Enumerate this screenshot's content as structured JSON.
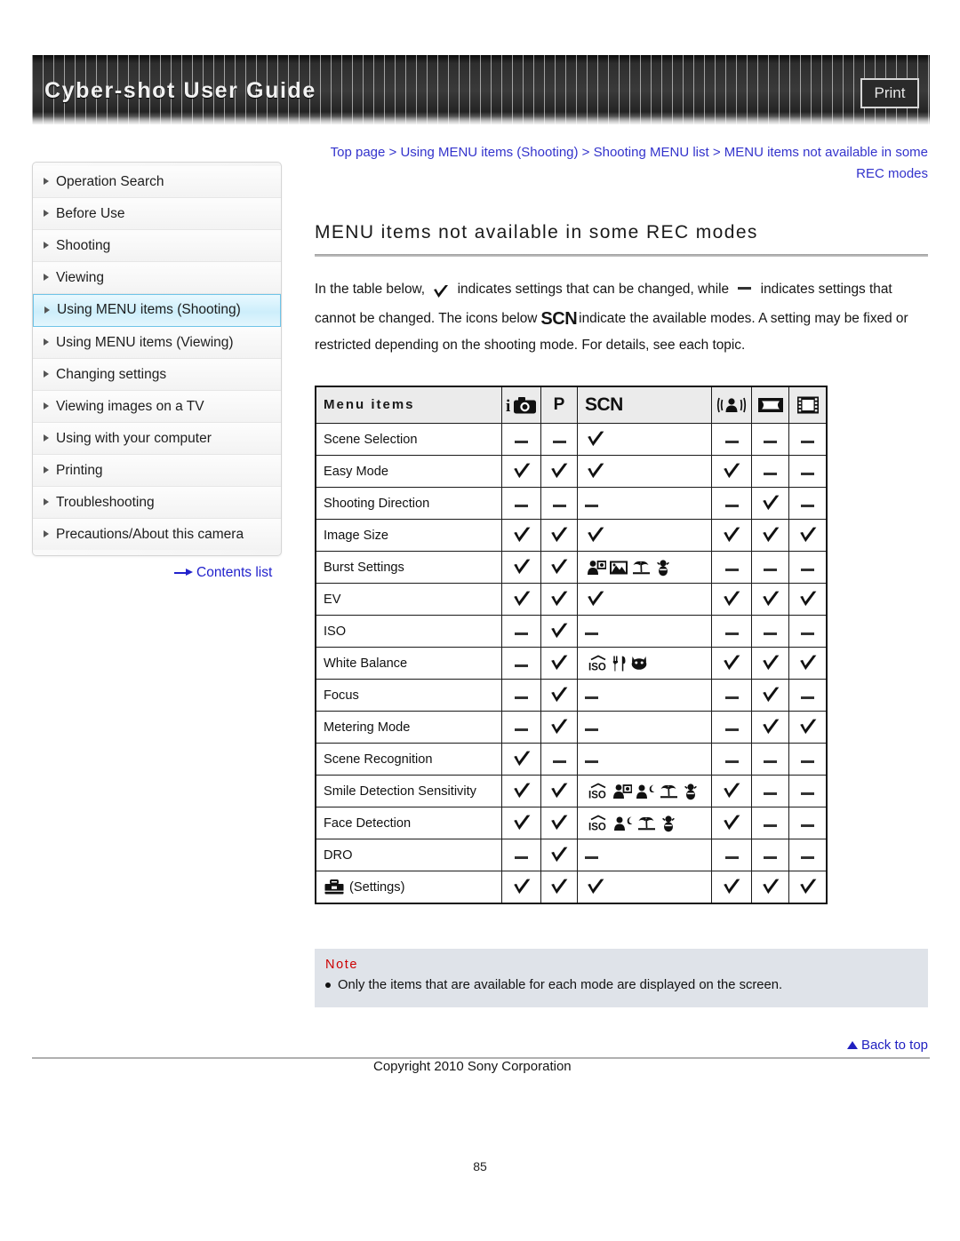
{
  "header": {
    "site_title": "Cyber-shot User Guide",
    "print_label": "Print"
  },
  "sidebar": {
    "items": [
      {
        "label": "Operation Search",
        "selected": false
      },
      {
        "label": "Before Use",
        "selected": false
      },
      {
        "label": "Shooting",
        "selected": false
      },
      {
        "label": "Viewing",
        "selected": false
      },
      {
        "label": "Using MENU items (Shooting)",
        "selected": true
      },
      {
        "label": "Using MENU items (Viewing)",
        "selected": false
      },
      {
        "label": "Changing settings",
        "selected": false
      },
      {
        "label": "Viewing images on a TV",
        "selected": false
      },
      {
        "label": "Using with your computer",
        "selected": false
      },
      {
        "label": "Printing",
        "selected": false
      },
      {
        "label": "Troubleshooting",
        "selected": false
      },
      {
        "label": "Precautions/About this camera",
        "selected": false
      }
    ],
    "contents_list_label": "Contents list"
  },
  "main": {
    "breadcrumb": "Top page > Using MENU items (Shooting) > Shooting MENU list > MENU items not available in some REC modes",
    "page_title": "MENU items not available in some REC modes",
    "intro_part1": "In the table below,",
    "intro_part2": "indicates settings that can be changed, while",
    "intro_part3": "indicates settings that cannot be changed. The icons below",
    "intro_scn": "SCN",
    "intro_part4": "indicate the available modes. A setting may be fixed or restricted depending on the shooting mode. For details, see each topic."
  },
  "table": {
    "header_label": "Menu items",
    "columns": [
      {
        "key": "iauto",
        "icon": "i-auto-camera-icon",
        "label": ""
      },
      {
        "key": "p",
        "icon": "program-auto-icon",
        "label": "P"
      },
      {
        "key": "scn",
        "icon": "scene-selection-icon",
        "label": "SCN"
      },
      {
        "key": "amb",
        "icon": "anti-motion-blur-icon",
        "label": ""
      },
      {
        "key": "pan",
        "icon": "sweep-panorama-icon",
        "label": ""
      },
      {
        "key": "mov",
        "icon": "movie-mode-icon",
        "label": ""
      }
    ],
    "rows": [
      {
        "label": "Scene Selection",
        "icon": null,
        "iauto": "dash",
        "p": "dash",
        "scn": "check",
        "scn_icons": [],
        "amb": "dash",
        "pan": "dash",
        "mov": "dash"
      },
      {
        "label": "Easy Mode",
        "icon": null,
        "iauto": "check",
        "p": "check",
        "scn": "check",
        "scn_icons": [],
        "amb": "check",
        "pan": "dash",
        "mov": "dash"
      },
      {
        "label": "Shooting Direction",
        "icon": null,
        "iauto": "dash",
        "p": "dash",
        "scn": "dash",
        "scn_icons": [],
        "amb": "dash",
        "pan": "check",
        "mov": "dash"
      },
      {
        "label": "Image Size",
        "icon": null,
        "iauto": "check",
        "p": "check",
        "scn": "check",
        "scn_icons": [],
        "amb": "check",
        "pan": "check",
        "mov": "check"
      },
      {
        "label": "Burst Settings",
        "icon": null,
        "iauto": "check",
        "p": "check",
        "scn": "icons",
        "scn_icons": [
          "soft-snap-icon",
          "landscape-icon",
          "beach-icon",
          "pet-icon"
        ],
        "amb": "dash",
        "pan": "dash",
        "mov": "dash"
      },
      {
        "label": "EV",
        "icon": null,
        "iauto": "check",
        "p": "check",
        "scn": "check",
        "scn_icons": [],
        "amb": "check",
        "pan": "check",
        "mov": "check"
      },
      {
        "label": "ISO",
        "icon": null,
        "iauto": "dash",
        "p": "check",
        "scn": "dash",
        "scn_icons": [],
        "amb": "dash",
        "pan": "dash",
        "mov": "dash"
      },
      {
        "label": "White Balance",
        "icon": null,
        "iauto": "dash",
        "p": "check",
        "scn": "icons",
        "scn_icons": [
          "high-sensitivity-icon",
          "gourmet-icon",
          "pet-cat-icon"
        ],
        "amb": "check",
        "pan": "check",
        "mov": "check"
      },
      {
        "label": "Focus",
        "icon": null,
        "iauto": "dash",
        "p": "check",
        "scn": "dash",
        "scn_icons": [],
        "amb": "dash",
        "pan": "check",
        "mov": "dash"
      },
      {
        "label": "Metering Mode",
        "icon": null,
        "iauto": "dash",
        "p": "check",
        "scn": "dash",
        "scn_icons": [],
        "amb": "dash",
        "pan": "check",
        "mov": "check"
      },
      {
        "label": "Scene Recognition",
        "icon": null,
        "iauto": "check",
        "p": "dash",
        "scn": "dash",
        "scn_icons": [],
        "amb": "dash",
        "pan": "dash",
        "mov": "dash"
      },
      {
        "label": "Smile Detection Sensitivity",
        "icon": null,
        "iauto": "check",
        "p": "check",
        "scn": "icons",
        "scn_icons": [
          "high-sensitivity-icon",
          "soft-snap-icon",
          "night-portrait-icon",
          "beach-icon",
          "pet-icon"
        ],
        "amb": "check",
        "pan": "dash",
        "mov": "dash"
      },
      {
        "label": "Face Detection",
        "icon": null,
        "iauto": "check",
        "p": "check",
        "scn": "icons",
        "scn_icons": [
          "high-sensitivity-icon",
          "night-portrait-icon",
          "beach-icon",
          "pet-icon"
        ],
        "amb": "check",
        "pan": "dash",
        "mov": "dash"
      },
      {
        "label": "DRO",
        "icon": null,
        "iauto": "dash",
        "p": "check",
        "scn": "dash",
        "scn_icons": [],
        "amb": "dash",
        "pan": "dash",
        "mov": "dash"
      },
      {
        "label": "(Settings)",
        "icon": "toolbox-icon",
        "iauto": "check",
        "p": "check",
        "scn": "check",
        "scn_icons": [],
        "amb": "check",
        "pan": "check",
        "mov": "check"
      }
    ]
  },
  "note": {
    "title": "Note",
    "item": "Only the items that are available for each mode are displayed on the screen."
  },
  "footer": {
    "back_to_top": "Back to top",
    "copyright": "Copyright 2010 Sony Corporation",
    "page_number": "85"
  },
  "colors": {
    "link": "#3333cc",
    "note_title": "#cc0000",
    "note_bg": "#dfe3e9",
    "selected_nav": "#cdeefb"
  }
}
